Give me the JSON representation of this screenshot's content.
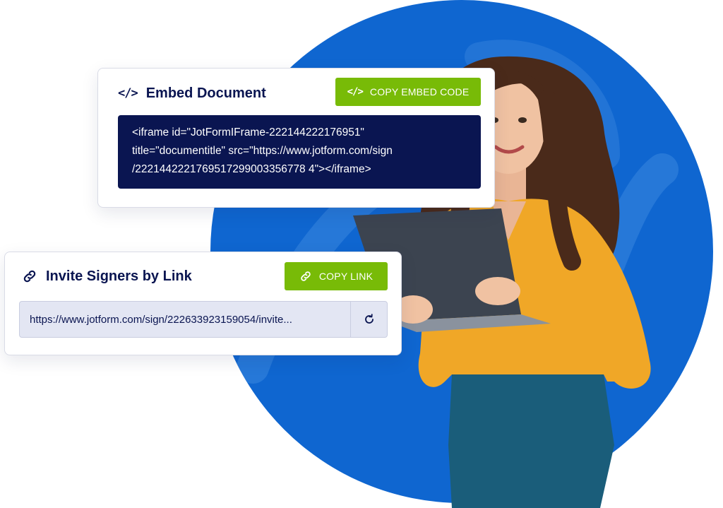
{
  "colors": {
    "brand_blue": "#0f66d0",
    "navy": "#0a1551",
    "button_green": "#78bb07",
    "field_bg": "#e3e6f3"
  },
  "embed_card": {
    "title": "Embed Document",
    "title_icon": "code-icon",
    "button_label": "COPY EMBED CODE",
    "button_icon": "code-icon",
    "code_lines": [
      "<iframe id=\"JotFormIFrame-222144222176951\"",
      "title=\"documentitle\" src=\"https://www.jotform.com/sign",
      "/2221442221769517299003356778 4\"></iframe>"
    ]
  },
  "invite_card": {
    "title": "Invite Signers by Link",
    "title_icon": "link-icon",
    "button_label": "COPY LINK",
    "button_icon": "link-icon",
    "link_value": "https://www.jotform.com/sign/222633923159054/invite...",
    "refresh_icon": "refresh-icon"
  },
  "illustration": {
    "subject": "woman-holding-laptop"
  }
}
